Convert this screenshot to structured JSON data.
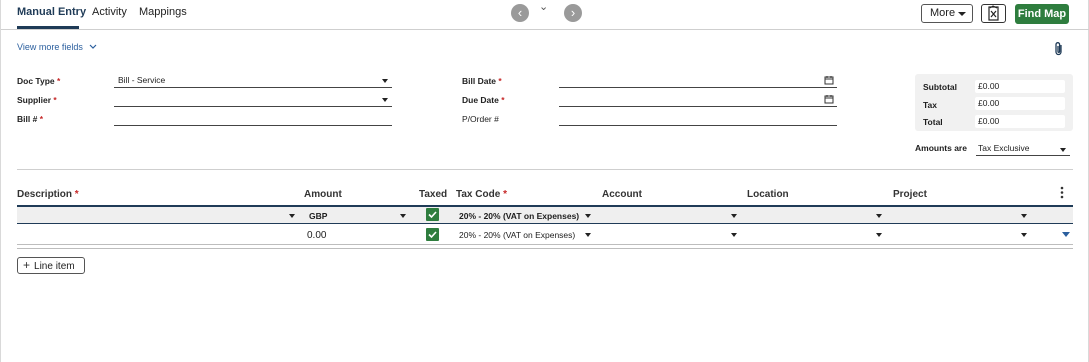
{
  "tabs": [
    {
      "label": "Manual Entry",
      "active": true
    },
    {
      "label": "Activity"
    },
    {
      "label": "Mappings"
    }
  ],
  "toolbar": {
    "more_label": "More",
    "find_map_label": "Find Map"
  },
  "view_more_label": "View more fields",
  "header": {
    "doc_type": {
      "label": "Doc Type",
      "value": "Bill - Service"
    },
    "supplier": {
      "label": "Supplier",
      "value": ""
    },
    "bill_no": {
      "label": "Bill #",
      "value": ""
    },
    "bill_date": {
      "label": "Bill Date",
      "value": ""
    },
    "due_date": {
      "label": "Due Date",
      "value": ""
    },
    "po": {
      "label": "P/Order #",
      "value": ""
    },
    "required_mark": "*"
  },
  "totals": {
    "subtotal_label": "Subtotal",
    "subtotal": "£0.00",
    "tax_label": "Tax",
    "tax": "£0.00",
    "total_label": "Total",
    "total": "£0.00"
  },
  "amounts_are": {
    "label": "Amounts are",
    "value": "Tax Exclusive"
  },
  "grid": {
    "columns": {
      "description": "Description",
      "amount": "Amount",
      "taxed": "Taxed",
      "tax_code": "Tax Code",
      "account": "Account",
      "location": "Location",
      "project": "Project"
    },
    "filter_row": {
      "currency": "GBP",
      "tax_code": "20% - 20% (VAT on Expenses)",
      "taxed": true
    },
    "lines": [
      {
        "description": "",
        "amount": "0.00",
        "taxed": true,
        "tax_code": "20% - 20% (VAT on Expenses)",
        "account": "",
        "location": "",
        "project": ""
      }
    ]
  },
  "add_line_label": "Line item",
  "colors": {
    "primary": "#1f3b57",
    "success": "#2e7d3e",
    "link": "#2b5f9e",
    "required": "#c62828"
  }
}
